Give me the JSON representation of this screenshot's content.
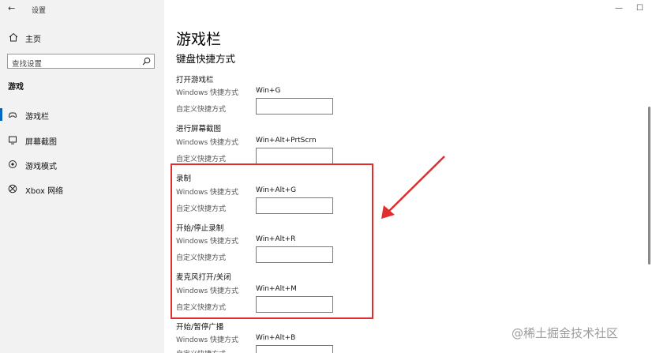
{
  "window": {
    "title": "设置",
    "back_glyph": "←",
    "min_glyph": "—",
    "max_glyph": "☐",
    "close_glyph": "✕"
  },
  "sidebar": {
    "home_label": "主页",
    "search_placeholder": "查找设置",
    "section": "游戏",
    "items": [
      {
        "label": "游戏栏",
        "icon": "game-bar-icon",
        "active": true
      },
      {
        "label": "屏幕截图",
        "icon": "screenshot-icon",
        "active": false
      },
      {
        "label": "游戏模式",
        "icon": "game-mode-icon",
        "active": false
      },
      {
        "label": "Xbox 网络",
        "icon": "xbox-icon",
        "active": false
      }
    ]
  },
  "main": {
    "title": "游戏栏",
    "subtitle": "键盘快捷方式",
    "windows_shortcut_label": "Windows 快捷方式",
    "custom_shortcut_label": "自定义快捷方式",
    "groups": [
      {
        "title": "打开游戏栏",
        "shortcut": "Win+G",
        "custom": ""
      },
      {
        "title": "进行屏幕截图",
        "shortcut": "Win+Alt+PrtScrn",
        "custom": ""
      },
      {
        "title": "录制",
        "shortcut": "Win+Alt+G",
        "custom": ""
      },
      {
        "title": "开始/停止录制",
        "shortcut": "Win+Alt+R",
        "custom": ""
      },
      {
        "title": "麦克风打开/关闭",
        "shortcut": "Win+Alt+M",
        "custom": ""
      },
      {
        "title": "开始/暂停广播",
        "shortcut": "Win+Alt+B",
        "custom": ""
      }
    ]
  },
  "annotation": {
    "highlight_color": "#e02d2d"
  },
  "watermark": "@稀土掘金技术社区"
}
